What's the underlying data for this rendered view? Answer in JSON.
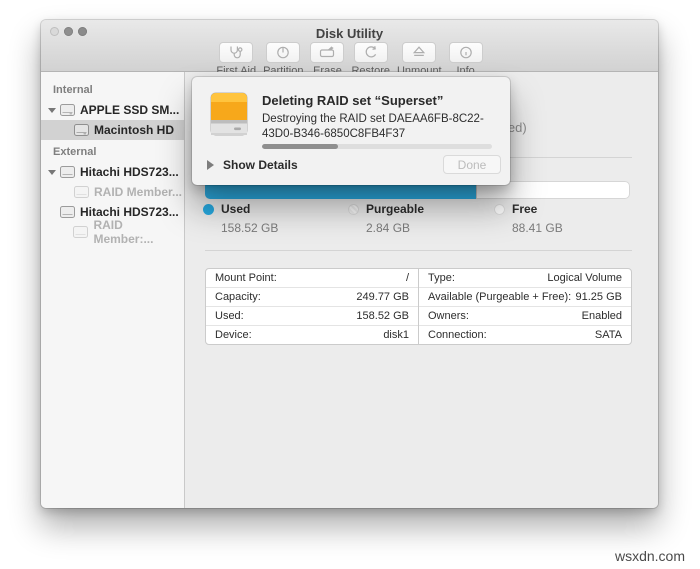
{
  "watermark": "wsxdn.com",
  "window": {
    "title": "Disk Utility",
    "toolbar": [
      {
        "label": "First Aid"
      },
      {
        "label": "Partition"
      },
      {
        "label": "Erase"
      },
      {
        "label": "Restore"
      },
      {
        "label": "Unmount"
      },
      {
        "label": "Info"
      }
    ],
    "sidebar": {
      "sections": [
        {
          "label": "Internal",
          "items": [
            {
              "label": "APPLE SSD SM..."
            },
            {
              "label": "Macintosh HD",
              "selected": true
            }
          ]
        },
        {
          "label": "External",
          "items": [
            {
              "label": "Hitachi HDS723..."
            },
            {
              "label": "RAID Member...",
              "disabled": true
            },
            {
              "label": "Hitachi HDS723..."
            },
            {
              "label": "RAID Member:...",
              "disabled": true
            }
          ]
        }
      ]
    },
    "dialog": {
      "title": "Deleting RAID set “Superset”",
      "message": "Destroying the RAID set DAEAA6FB-8C22-43D0-B346-6850C8FB4F37",
      "progress_percent": 33,
      "show_details_label": "Show Details",
      "done_label": "Done"
    },
    "main": {
      "format_fragment": "led)",
      "usage": {
        "used_percent": 64,
        "used_color": "#27aae1"
      },
      "legend": [
        {
          "label": "Used",
          "value": "158.52 GB"
        },
        {
          "label": "Purgeable",
          "value": "2.84 GB"
        },
        {
          "label": "Free",
          "value": "88.41 GB"
        }
      ],
      "info_table": {
        "left": [
          {
            "label": "Mount Point:",
            "value": "/"
          },
          {
            "label": "Capacity:",
            "value": "249.77 GB"
          },
          {
            "label": "Used:",
            "value": "158.52 GB"
          },
          {
            "label": "Device:",
            "value": "disk1"
          }
        ],
        "right": [
          {
            "label": "Type:",
            "value": "Logical Volume"
          },
          {
            "label": "Available (Purgeable + Free):",
            "value": "91.25 GB"
          },
          {
            "label": "Owners:",
            "value": "Enabled"
          },
          {
            "label": "Connection:",
            "value": "SATA"
          }
        ]
      }
    }
  }
}
